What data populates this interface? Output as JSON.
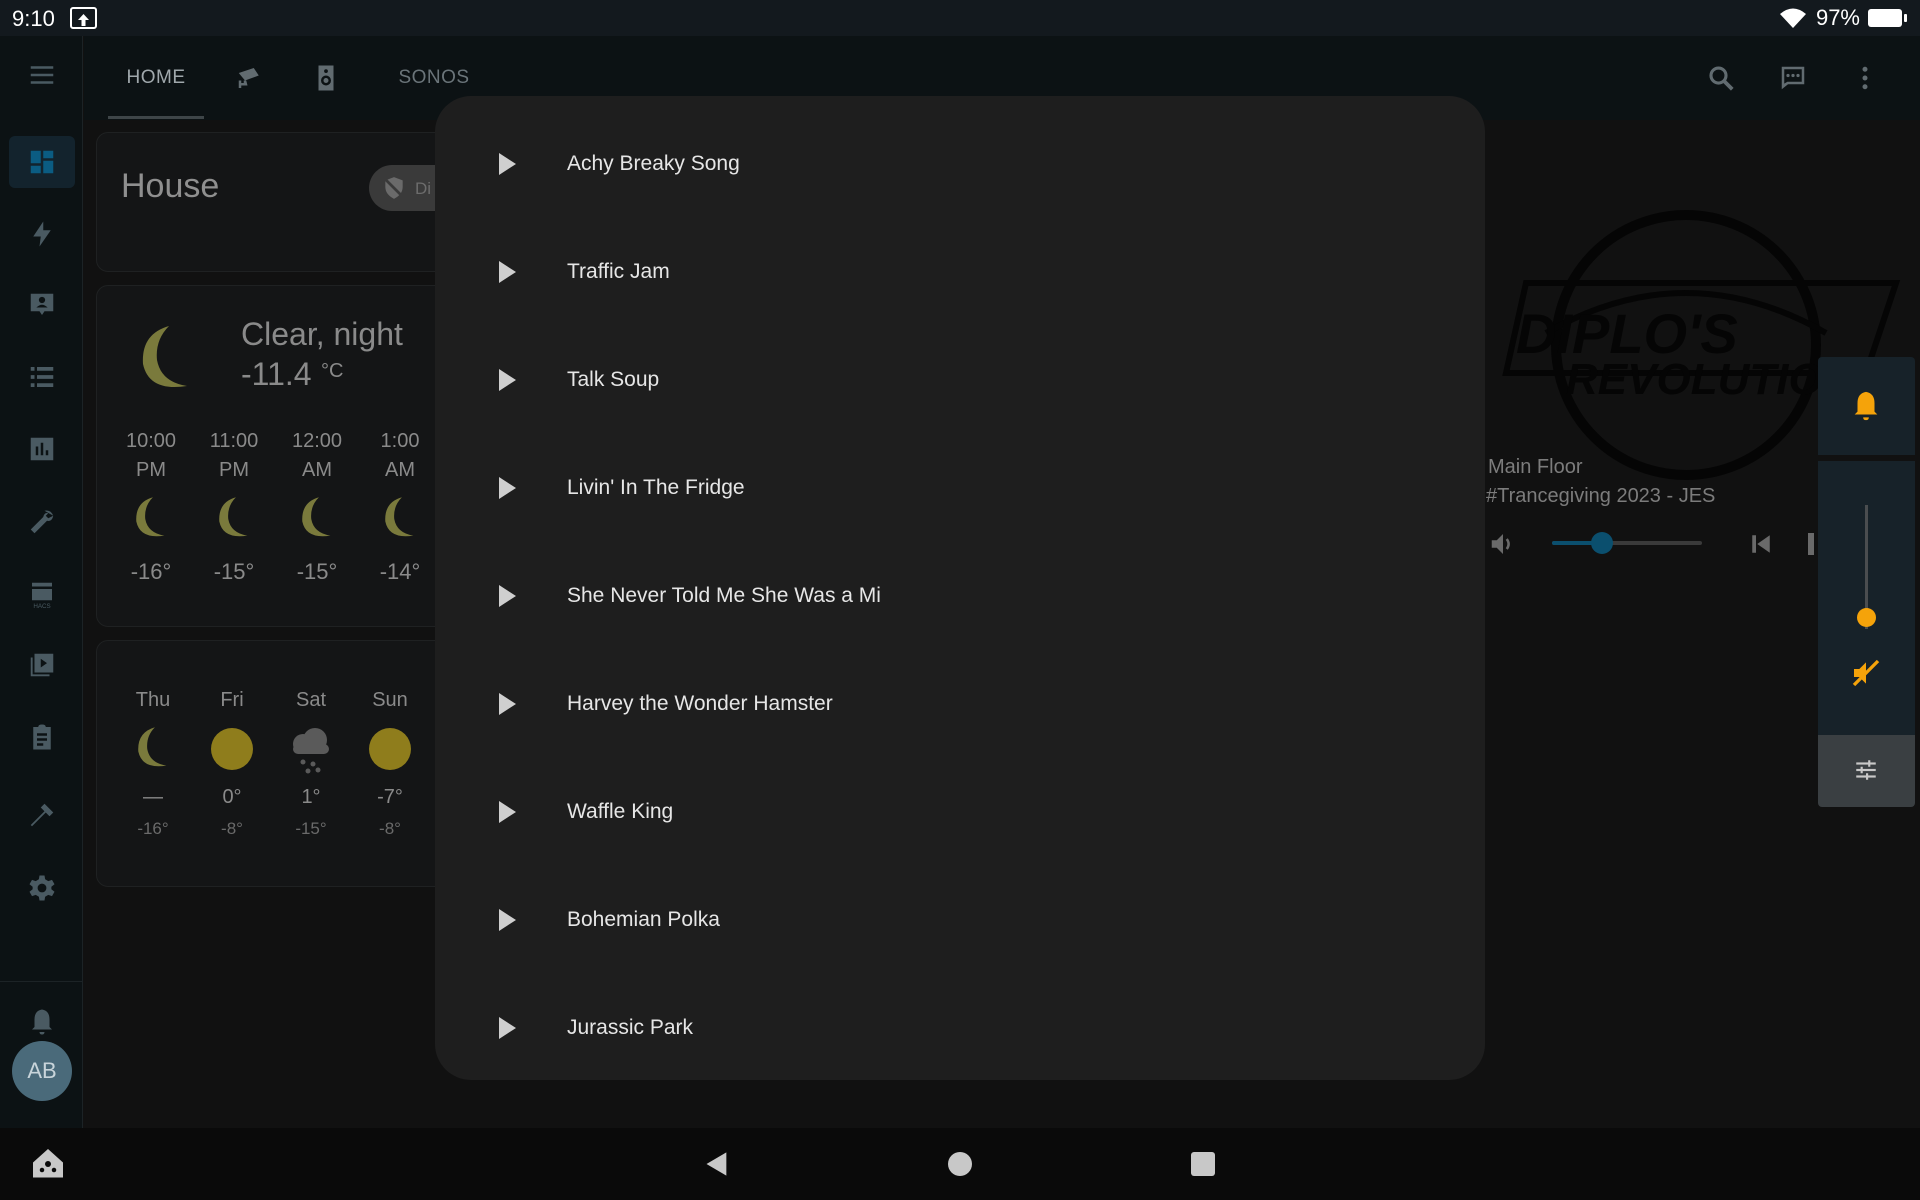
{
  "status_bar": {
    "time": "9:10",
    "battery": "97%"
  },
  "header": {
    "tabs": [
      {
        "label": "HOME",
        "type": "text"
      },
      {
        "label": "",
        "type": "icon",
        "icon": "camera-icon"
      },
      {
        "label": "",
        "type": "icon",
        "icon": "speaker-icon"
      },
      {
        "label": "SONOS",
        "type": "text"
      }
    ]
  },
  "sidebar": {
    "items": [
      "dashboard-icon",
      "lightning-icon",
      "person-card-icon",
      "list-icon",
      "chart-icon",
      "wrench-icon",
      "hacs-icon",
      "media-icon",
      "clipboard-icon",
      "hammer-icon",
      "gear-icon"
    ],
    "notifications_icon": "bell-icon",
    "avatar": "AB"
  },
  "house_card": {
    "title": "House",
    "chip": "Di"
  },
  "weather": {
    "condition": "Clear, night",
    "temperature": "-11.4",
    "unit": "°C",
    "hourly": [
      {
        "time": "10:00",
        "ampm": "PM",
        "temp": "-16°"
      },
      {
        "time": "11:00",
        "ampm": "PM",
        "temp": "-15°"
      },
      {
        "time": "12:00",
        "ampm": "AM",
        "temp": "-15°"
      },
      {
        "time": "1:00",
        "ampm": "AM",
        "temp": "-14°"
      }
    ],
    "daily": [
      {
        "day": "Thu",
        "icon": "moon-icon",
        "high": "—",
        "low": "-16°"
      },
      {
        "day": "Fri",
        "icon": "sun-icon",
        "high": "0°",
        "low": "-8°"
      },
      {
        "day": "Sat",
        "icon": "snow-cloud-icon",
        "high": "1°",
        "low": "-15°"
      },
      {
        "day": "Sun",
        "icon": "sun-icon",
        "high": "-7°",
        "low": "-8°"
      }
    ]
  },
  "media_player": {
    "art_text_1": "DIPLO'S",
    "art_text_2": "REVOLUTIO",
    "room": "Main Floor",
    "track": "#Trancegiving 2023 - JES",
    "volume_fraction": 0.33
  },
  "volume_panel": {
    "level_fraction": 0.1
  },
  "dialog": {
    "tracks": [
      "Achy Breaky Song",
      "Traffic Jam",
      "Talk Soup",
      "Livin' In The Fridge",
      "She Never Told Me She Was a Mi",
      "Harvey the Wonder Hamster",
      "Waffle King",
      "Bohemian Polka",
      "Jurassic Park"
    ]
  },
  "colors": {
    "accent": "#0b5c82",
    "warning": "#f5a30a",
    "moon": "#7a7a3c",
    "sun": "#8f7d1c"
  }
}
